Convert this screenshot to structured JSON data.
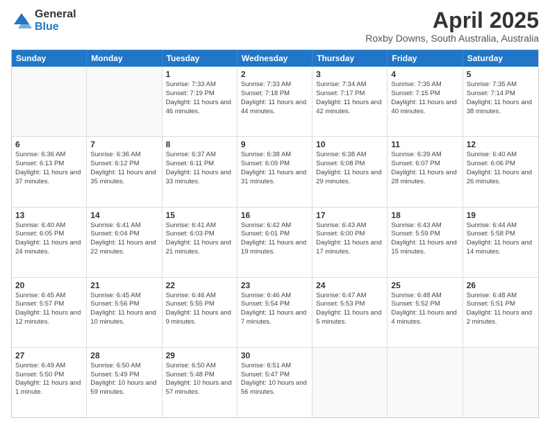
{
  "logo": {
    "general": "General",
    "blue": "Blue"
  },
  "title": "April 2025",
  "location": "Roxby Downs, South Australia, Australia",
  "days_of_week": [
    "Sunday",
    "Monday",
    "Tuesday",
    "Wednesday",
    "Thursday",
    "Friday",
    "Saturday"
  ],
  "weeks": [
    [
      {
        "day": "",
        "info": ""
      },
      {
        "day": "",
        "info": ""
      },
      {
        "day": "1",
        "info": "Sunrise: 7:33 AM\nSunset: 7:19 PM\nDaylight: 11 hours and 46 minutes."
      },
      {
        "day": "2",
        "info": "Sunrise: 7:33 AM\nSunset: 7:18 PM\nDaylight: 11 hours and 44 minutes."
      },
      {
        "day": "3",
        "info": "Sunrise: 7:34 AM\nSunset: 7:17 PM\nDaylight: 11 hours and 42 minutes."
      },
      {
        "day": "4",
        "info": "Sunrise: 7:35 AM\nSunset: 7:15 PM\nDaylight: 11 hours and 40 minutes."
      },
      {
        "day": "5",
        "info": "Sunrise: 7:35 AM\nSunset: 7:14 PM\nDaylight: 11 hours and 38 minutes."
      }
    ],
    [
      {
        "day": "6",
        "info": "Sunrise: 6:36 AM\nSunset: 6:13 PM\nDaylight: 11 hours and 37 minutes."
      },
      {
        "day": "7",
        "info": "Sunrise: 6:36 AM\nSunset: 6:12 PM\nDaylight: 11 hours and 35 minutes."
      },
      {
        "day": "8",
        "info": "Sunrise: 6:37 AM\nSunset: 6:11 PM\nDaylight: 11 hours and 33 minutes."
      },
      {
        "day": "9",
        "info": "Sunrise: 6:38 AM\nSunset: 6:09 PM\nDaylight: 11 hours and 31 minutes."
      },
      {
        "day": "10",
        "info": "Sunrise: 6:38 AM\nSunset: 6:08 PM\nDaylight: 11 hours and 29 minutes."
      },
      {
        "day": "11",
        "info": "Sunrise: 6:39 AM\nSunset: 6:07 PM\nDaylight: 11 hours and 28 minutes."
      },
      {
        "day": "12",
        "info": "Sunrise: 6:40 AM\nSunset: 6:06 PM\nDaylight: 11 hours and 26 minutes."
      }
    ],
    [
      {
        "day": "13",
        "info": "Sunrise: 6:40 AM\nSunset: 6:05 PM\nDaylight: 11 hours and 24 minutes."
      },
      {
        "day": "14",
        "info": "Sunrise: 6:41 AM\nSunset: 6:04 PM\nDaylight: 11 hours and 22 minutes."
      },
      {
        "day": "15",
        "info": "Sunrise: 6:41 AM\nSunset: 6:03 PM\nDaylight: 11 hours and 21 minutes."
      },
      {
        "day": "16",
        "info": "Sunrise: 6:42 AM\nSunset: 6:01 PM\nDaylight: 11 hours and 19 minutes."
      },
      {
        "day": "17",
        "info": "Sunrise: 6:43 AM\nSunset: 6:00 PM\nDaylight: 11 hours and 17 minutes."
      },
      {
        "day": "18",
        "info": "Sunrise: 6:43 AM\nSunset: 5:59 PM\nDaylight: 11 hours and 15 minutes."
      },
      {
        "day": "19",
        "info": "Sunrise: 6:44 AM\nSunset: 5:58 PM\nDaylight: 11 hours and 14 minutes."
      }
    ],
    [
      {
        "day": "20",
        "info": "Sunrise: 6:45 AM\nSunset: 5:57 PM\nDaylight: 11 hours and 12 minutes."
      },
      {
        "day": "21",
        "info": "Sunrise: 6:45 AM\nSunset: 5:56 PM\nDaylight: 11 hours and 10 minutes."
      },
      {
        "day": "22",
        "info": "Sunrise: 6:46 AM\nSunset: 5:55 PM\nDaylight: 11 hours and 9 minutes."
      },
      {
        "day": "23",
        "info": "Sunrise: 6:46 AM\nSunset: 5:54 PM\nDaylight: 11 hours and 7 minutes."
      },
      {
        "day": "24",
        "info": "Sunrise: 6:47 AM\nSunset: 5:53 PM\nDaylight: 11 hours and 5 minutes."
      },
      {
        "day": "25",
        "info": "Sunrise: 6:48 AM\nSunset: 5:52 PM\nDaylight: 11 hours and 4 minutes."
      },
      {
        "day": "26",
        "info": "Sunrise: 6:48 AM\nSunset: 5:51 PM\nDaylight: 11 hours and 2 minutes."
      }
    ],
    [
      {
        "day": "27",
        "info": "Sunrise: 6:49 AM\nSunset: 5:50 PM\nDaylight: 11 hours and 1 minute."
      },
      {
        "day": "28",
        "info": "Sunrise: 6:50 AM\nSunset: 5:49 PM\nDaylight: 10 hours and 59 minutes."
      },
      {
        "day": "29",
        "info": "Sunrise: 6:50 AM\nSunset: 5:48 PM\nDaylight: 10 hours and 57 minutes."
      },
      {
        "day": "30",
        "info": "Sunrise: 6:51 AM\nSunset: 5:47 PM\nDaylight: 10 hours and 56 minutes."
      },
      {
        "day": "",
        "info": ""
      },
      {
        "day": "",
        "info": ""
      },
      {
        "day": "",
        "info": ""
      }
    ]
  ]
}
